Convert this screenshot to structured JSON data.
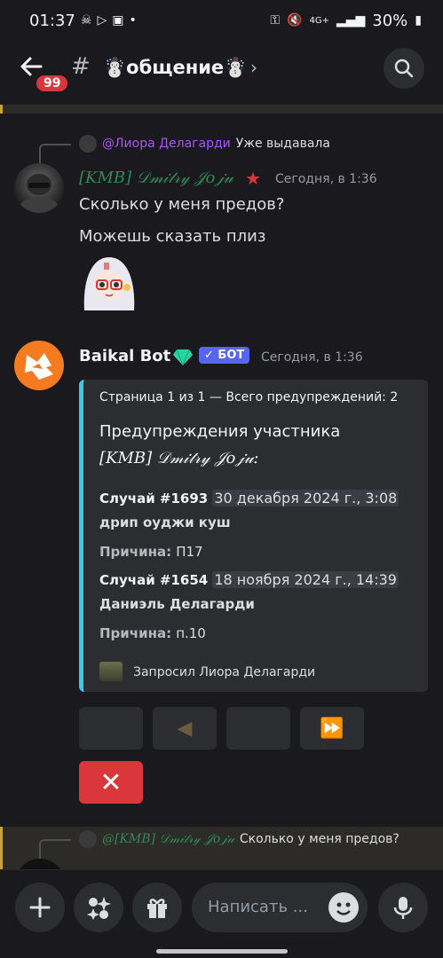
{
  "status_bar": {
    "time": "01:37",
    "battery": "30%",
    "network": "4G+",
    "icons": [
      "skull-icon",
      "play-store-icon",
      "calendar-icon",
      "dot-icon",
      "key-icon",
      "mute-icon",
      "volte-icon",
      "signal-icon",
      "battery-icon"
    ]
  },
  "header": {
    "unread_count": "99",
    "channel_prefix": "#",
    "channel_name": "☃️общение☃️",
    "chevron": "›"
  },
  "message1": {
    "reply_mention": "@Лиора Делагарди",
    "reply_text": "Уже выдавала",
    "username": "[KMB] 𝒟𝓂𝒾𝓉𝓇𝓎 𝒥𝑜𝒿𝓊",
    "user_badge": "★",
    "timestamp": "Сегодня, в 1:36",
    "lines": [
      "Сколько у меня предов?",
      "Можешь сказать плиз"
    ]
  },
  "message2": {
    "username": "Baikal Bot",
    "bot_badge": "✓ БОТ",
    "timestamp": "Сегодня, в 1:36",
    "embed": {
      "author": "Страница 1 из 1 — Всего предупреждений: 2",
      "title_line1": "Предупреждения участника",
      "title_line2": "[KMB] 𝒟𝓂𝒾𝓉𝓇𝓎 𝒥𝑜𝒿𝓊:",
      "cases": [
        {
          "label": "Случай  #1693",
          "date": "30 декабря 2024 г., 3:08",
          "moderator": "дрип оуджи куш",
          "reason_label": "Причина:",
          "reason": "П17"
        },
        {
          "label": "Случай  #1654",
          "date": "18 ноября 2024 г., 14:39",
          "moderator": "Даниэль Делагарди",
          "reason_label": "Причина:",
          "reason": "п.10"
        }
      ],
      "footer": "Запросил Лиора Делагарди"
    },
    "buttons": [
      "",
      "◀",
      "",
      "⏩"
    ],
    "close_button": "✕"
  },
  "next_message": {
    "reply_name": "@[KMB] 𝒟𝓂𝒾𝓉𝓇𝓎 𝒥𝑜𝒿𝓊",
    "reply_text": "Сколько у меня предов?"
  },
  "composer": {
    "placeholder": "Написать ..."
  },
  "colors": {
    "accent_blurple": "#5865f2",
    "embed_bar": "#3fc7ea",
    "danger": "#da373c",
    "mention": "#a855f7",
    "highlight_bar": "#c7a339"
  }
}
